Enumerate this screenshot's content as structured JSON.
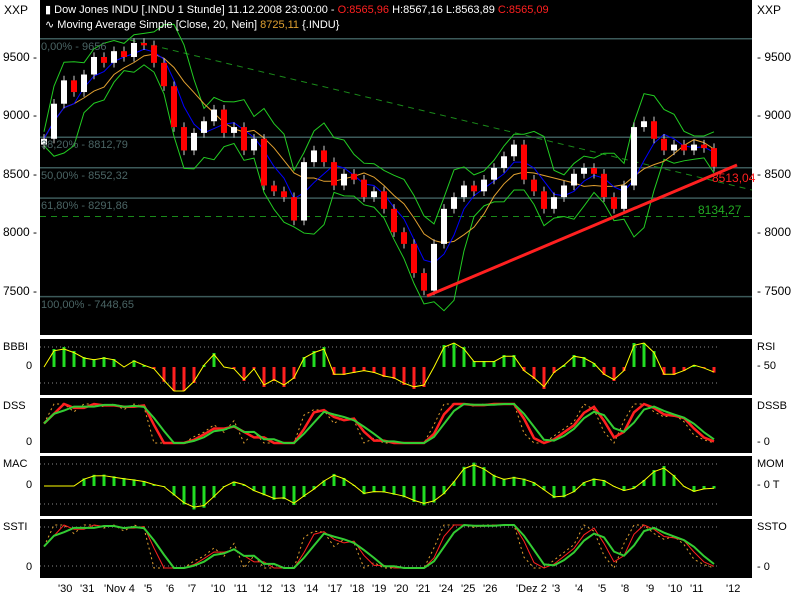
{
  "header": {
    "title": "Dow Jones INDU [.INDU  1 Stunde] 11.12.2008 23:00:00 - ",
    "open": "O:8565,96",
    "high": "H:8567,16",
    "low": "L:8563,89",
    "close": "C:8565,09",
    "ma_label": "Moving Average Simple [Close, 20, Nein]",
    "ma_value": "8725,11",
    "ma_symbol": "{.INDU}"
  },
  "axis_unit": "XXP",
  "colors": {
    "up": "#ffffff",
    "down": "#ff0000",
    "ma": "#0000ff",
    "ma2": "#e0a030",
    "bands": "#22cc22",
    "fib": "#3c5a5a",
    "trend": "#ff2020"
  },
  "chart_data": {
    "type": "candlestick",
    "title": "Dow Jones INDU [.INDU 1 Stunde]",
    "y_ticks": [
      9500,
      9000,
      8500,
      8000,
      7500
    ],
    "ylim": [
      7400,
      9800
    ],
    "closes": [
      8800,
      9100,
      9300,
      9200,
      9350,
      9500,
      9450,
      9550,
      9500,
      9620,
      9600,
      9450,
      9250,
      8900,
      8700,
      8850,
      8950,
      9050,
      8850,
      8900,
      8700,
      8800,
      8400,
      8350,
      8300,
      8100,
      8600,
      8700,
      8600,
      8400,
      8500,
      8450,
      8300,
      8350,
      8200,
      8000,
      7900,
      7650,
      7500,
      7900,
      8200,
      8300,
      8400,
      8350,
      8450,
      8550,
      8650,
      8750,
      8450,
      8350,
      8200,
      8300,
      8400,
      8500,
      8550,
      8500,
      8300,
      8200,
      8400,
      8900,
      8950,
      8800,
      8700,
      8750,
      8700,
      8750,
      8720,
      8560
    ],
    "fib_levels": [
      {
        "label": "0,00% - 9656",
        "value": 9656
      },
      {
        "label": "38,20% - 8812,79",
        "value": 8812.79
      },
      {
        "label": "50,00% - 8552,32",
        "value": 8552.32
      },
      {
        "label": "61,80% - 8291,86",
        "value": 8291.86
      },
      {
        "label": "100,00% - 7448,65",
        "value": 7448.65
      }
    ],
    "support_line": {
      "value": 8134.27,
      "label": "8134,27"
    },
    "trend_label": "8513,04",
    "x_labels": [
      "30",
      "31",
      "Nov 4",
      "5",
      "6",
      "7",
      "10",
      "11",
      "12",
      "13",
      "14",
      "17",
      "18",
      "19",
      "20",
      "21",
      "24",
      "25",
      "26",
      "Dez 2",
      "3",
      "4",
      "5",
      "8",
      "9",
      "10",
      "11",
      "12"
    ],
    "indicators": [
      {
        "left": "BBBI",
        "right": "RSI",
        "left_tick": "0",
        "right_tick": "50"
      },
      {
        "left": "DSS",
        "right": "DSSB",
        "left_tick": "0",
        "right_tick": "0"
      },
      {
        "left": "MAC",
        "right": "MOM",
        "left_tick": "0",
        "right_tick": "0 T"
      },
      {
        "left": "SSTI",
        "right": "SSTO",
        "left_tick": "0",
        "right_tick": "0"
      }
    ]
  }
}
